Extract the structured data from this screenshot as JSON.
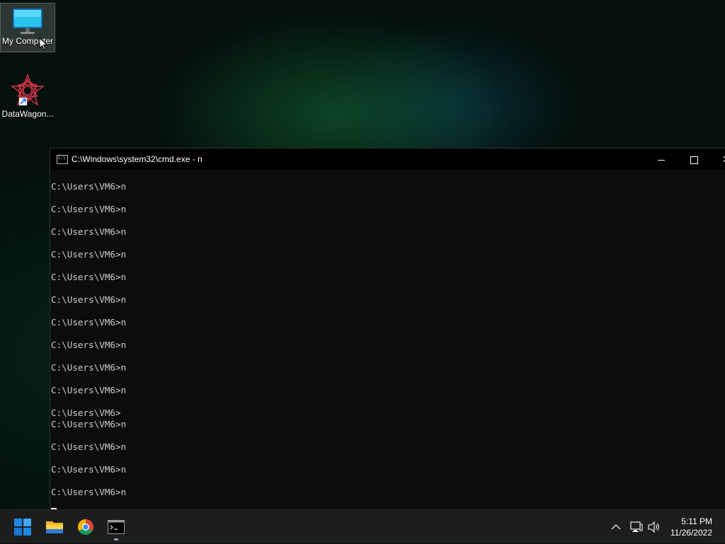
{
  "desktop": {
    "icons": [
      {
        "label": "My Computer",
        "icon": "monitor-icon"
      },
      {
        "label": "DataWagon...",
        "icon": "datawagon-icon"
      }
    ]
  },
  "window": {
    "title": "C:\\Windows\\system32\\cmd.exe - n",
    "console_lines": [
      "C:\\Users\\VM6>n",
      "",
      "C:\\Users\\VM6>n",
      "",
      "C:\\Users\\VM6>n",
      "",
      "C:\\Users\\VM6>n",
      "",
      "C:\\Users\\VM6>n",
      "",
      "C:\\Users\\VM6>n",
      "",
      "C:\\Users\\VM6>n",
      "",
      "C:\\Users\\VM6>n",
      "",
      "C:\\Users\\VM6>n",
      "",
      "C:\\Users\\VM6>n",
      "",
      "C:\\Users\\VM6>",
      "C:\\Users\\VM6>n",
      "",
      "C:\\Users\\VM6>n",
      "",
      "C:\\Users\\VM6>n",
      "",
      "C:\\Users\\VM6>n"
    ]
  },
  "taskbar": {
    "apps": [
      "start-icon",
      "file-explorer-icon",
      "chrome-icon",
      "terminal-icon"
    ],
    "time": "5:11 PM",
    "date": "11/26/2022"
  },
  "colors": {
    "console_bg": "#0c0c0c",
    "console_text": "#cccccc",
    "taskbar_bg": "#1c1d1f",
    "start_blue": "#1e88e5"
  }
}
